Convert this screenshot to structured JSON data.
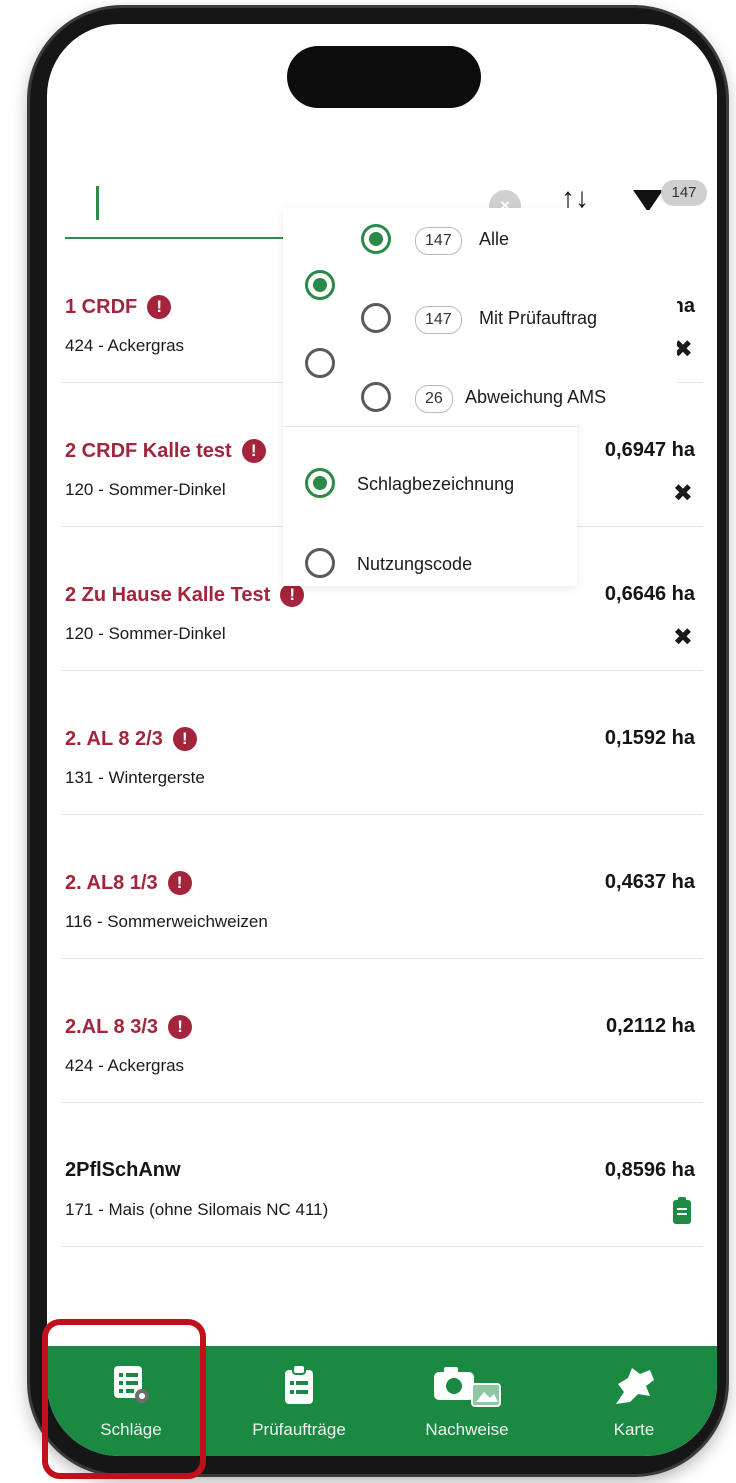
{
  "search": {
    "value": "",
    "filter_count": "147"
  },
  "fields": [
    {
      "name": "1 CRDF",
      "warning": true,
      "code": "424 - Ackergras",
      "area": ") ha",
      "icon": "map-icon"
    },
    {
      "name": "2 CRDF Kalle test",
      "warning": true,
      "code": "120 - Sommer-Dinkel",
      "area": "0,6947 ha",
      "icon": "map-icon"
    },
    {
      "name": "2 Zu Hause Kalle Test",
      "warning": true,
      "code": "120 - Sommer-Dinkel",
      "area": "0,6646 ha",
      "icon": "map-icon"
    },
    {
      "name": "2. AL 8 2/3",
      "warning": true,
      "code": "131 - Wintergerste",
      "area": "0,1592 ha",
      "icon": ""
    },
    {
      "name": "2. AL8 1/3",
      "warning": true,
      "code": "116 - Sommerweichweizen",
      "area": "0,4637 ha",
      "icon": ""
    },
    {
      "name": "2.AL 8 3/3",
      "warning": true,
      "code": "424 - Ackergras",
      "area": "0,2112 ha",
      "icon": ""
    },
    {
      "name": "2PflSchAnw",
      "warning": false,
      "code": "171 - Mais (ohne Silomais NC 411)",
      "area": "0,8596 ha",
      "icon": "clipboard-icon"
    }
  ],
  "filter_options": [
    {
      "count": "147",
      "label": "Alle",
      "selected": true
    },
    {
      "count": "147",
      "label": "Mit Prüfauftrag",
      "selected": false
    },
    {
      "count": "26",
      "label": "Abweichung AMS",
      "selected": false
    }
  ],
  "sort_options": [
    {
      "label": "Schlagbezeichnung",
      "selected": true
    },
    {
      "label": "Nutzungscode",
      "selected": false
    }
  ],
  "nav": {
    "items": [
      {
        "label": "Schläge",
        "icon": "list-icon",
        "active": true
      },
      {
        "label": "Prüfaufträge",
        "icon": "clipboard-icon",
        "active": false
      },
      {
        "label": "Nachweise",
        "icon": "camera-icon",
        "active": false
      },
      {
        "label": "Karte",
        "icon": "map-icon",
        "active": false
      }
    ]
  },
  "colors": {
    "accent": "#1a8a43",
    "warning": "#a4243b",
    "highlight": "#c0101a"
  }
}
